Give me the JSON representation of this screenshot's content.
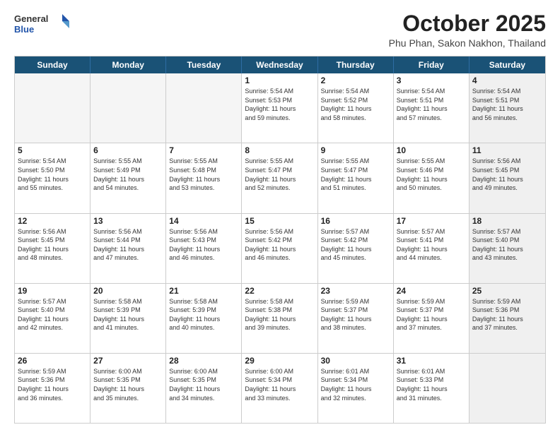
{
  "header": {
    "logo_general": "General",
    "logo_blue": "Blue",
    "month": "October 2025",
    "location": "Phu Phan, Sakon Nakhon, Thailand"
  },
  "weekdays": [
    "Sunday",
    "Monday",
    "Tuesday",
    "Wednesday",
    "Thursday",
    "Friday",
    "Saturday"
  ],
  "rows": [
    [
      {
        "day": "",
        "info": "",
        "empty": true
      },
      {
        "day": "",
        "info": "",
        "empty": true
      },
      {
        "day": "",
        "info": "",
        "empty": true
      },
      {
        "day": "1",
        "info": "Sunrise: 5:54 AM\nSunset: 5:53 PM\nDaylight: 11 hours\nand 59 minutes."
      },
      {
        "day": "2",
        "info": "Sunrise: 5:54 AM\nSunset: 5:52 PM\nDaylight: 11 hours\nand 58 minutes."
      },
      {
        "day": "3",
        "info": "Sunrise: 5:54 AM\nSunset: 5:51 PM\nDaylight: 11 hours\nand 57 minutes."
      },
      {
        "day": "4",
        "info": "Sunrise: 5:54 AM\nSunset: 5:51 PM\nDaylight: 11 hours\nand 56 minutes.",
        "shaded": true
      }
    ],
    [
      {
        "day": "5",
        "info": "Sunrise: 5:54 AM\nSunset: 5:50 PM\nDaylight: 11 hours\nand 55 minutes."
      },
      {
        "day": "6",
        "info": "Sunrise: 5:55 AM\nSunset: 5:49 PM\nDaylight: 11 hours\nand 54 minutes."
      },
      {
        "day": "7",
        "info": "Sunrise: 5:55 AM\nSunset: 5:48 PM\nDaylight: 11 hours\nand 53 minutes."
      },
      {
        "day": "8",
        "info": "Sunrise: 5:55 AM\nSunset: 5:47 PM\nDaylight: 11 hours\nand 52 minutes."
      },
      {
        "day": "9",
        "info": "Sunrise: 5:55 AM\nSunset: 5:47 PM\nDaylight: 11 hours\nand 51 minutes."
      },
      {
        "day": "10",
        "info": "Sunrise: 5:55 AM\nSunset: 5:46 PM\nDaylight: 11 hours\nand 50 minutes."
      },
      {
        "day": "11",
        "info": "Sunrise: 5:56 AM\nSunset: 5:45 PM\nDaylight: 11 hours\nand 49 minutes.",
        "shaded": true
      }
    ],
    [
      {
        "day": "12",
        "info": "Sunrise: 5:56 AM\nSunset: 5:45 PM\nDaylight: 11 hours\nand 48 minutes."
      },
      {
        "day": "13",
        "info": "Sunrise: 5:56 AM\nSunset: 5:44 PM\nDaylight: 11 hours\nand 47 minutes."
      },
      {
        "day": "14",
        "info": "Sunrise: 5:56 AM\nSunset: 5:43 PM\nDaylight: 11 hours\nand 46 minutes."
      },
      {
        "day": "15",
        "info": "Sunrise: 5:56 AM\nSunset: 5:42 PM\nDaylight: 11 hours\nand 46 minutes."
      },
      {
        "day": "16",
        "info": "Sunrise: 5:57 AM\nSunset: 5:42 PM\nDaylight: 11 hours\nand 45 minutes."
      },
      {
        "day": "17",
        "info": "Sunrise: 5:57 AM\nSunset: 5:41 PM\nDaylight: 11 hours\nand 44 minutes."
      },
      {
        "day": "18",
        "info": "Sunrise: 5:57 AM\nSunset: 5:40 PM\nDaylight: 11 hours\nand 43 minutes.",
        "shaded": true
      }
    ],
    [
      {
        "day": "19",
        "info": "Sunrise: 5:57 AM\nSunset: 5:40 PM\nDaylight: 11 hours\nand 42 minutes."
      },
      {
        "day": "20",
        "info": "Sunrise: 5:58 AM\nSunset: 5:39 PM\nDaylight: 11 hours\nand 41 minutes."
      },
      {
        "day": "21",
        "info": "Sunrise: 5:58 AM\nSunset: 5:39 PM\nDaylight: 11 hours\nand 40 minutes."
      },
      {
        "day": "22",
        "info": "Sunrise: 5:58 AM\nSunset: 5:38 PM\nDaylight: 11 hours\nand 39 minutes."
      },
      {
        "day": "23",
        "info": "Sunrise: 5:59 AM\nSunset: 5:37 PM\nDaylight: 11 hours\nand 38 minutes."
      },
      {
        "day": "24",
        "info": "Sunrise: 5:59 AM\nSunset: 5:37 PM\nDaylight: 11 hours\nand 37 minutes."
      },
      {
        "day": "25",
        "info": "Sunrise: 5:59 AM\nSunset: 5:36 PM\nDaylight: 11 hours\nand 37 minutes.",
        "shaded": true
      }
    ],
    [
      {
        "day": "26",
        "info": "Sunrise: 5:59 AM\nSunset: 5:36 PM\nDaylight: 11 hours\nand 36 minutes."
      },
      {
        "day": "27",
        "info": "Sunrise: 6:00 AM\nSunset: 5:35 PM\nDaylight: 11 hours\nand 35 minutes."
      },
      {
        "day": "28",
        "info": "Sunrise: 6:00 AM\nSunset: 5:35 PM\nDaylight: 11 hours\nand 34 minutes."
      },
      {
        "day": "29",
        "info": "Sunrise: 6:00 AM\nSunset: 5:34 PM\nDaylight: 11 hours\nand 33 minutes."
      },
      {
        "day": "30",
        "info": "Sunrise: 6:01 AM\nSunset: 5:34 PM\nDaylight: 11 hours\nand 32 minutes."
      },
      {
        "day": "31",
        "info": "Sunrise: 6:01 AM\nSunset: 5:33 PM\nDaylight: 11 hours\nand 31 minutes."
      },
      {
        "day": "",
        "info": "",
        "empty": true,
        "shaded": true
      }
    ]
  ]
}
